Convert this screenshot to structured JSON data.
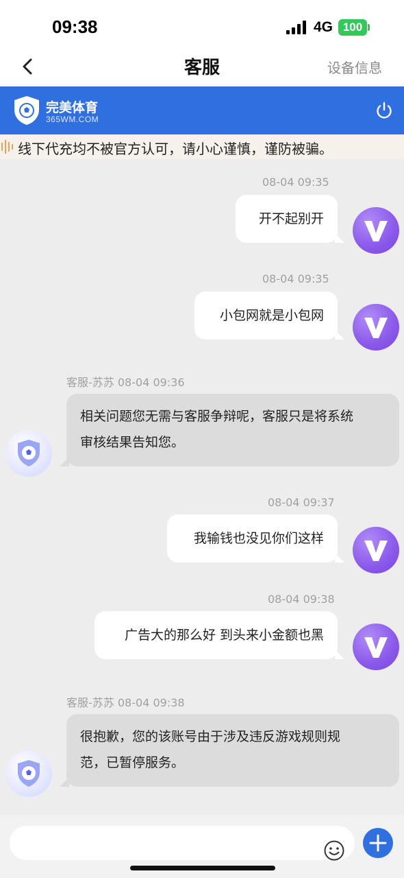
{
  "status_bar": {
    "time": "09:38",
    "network": "4G",
    "battery": "100"
  },
  "nav": {
    "title": "客服",
    "action": "设备信息"
  },
  "brand": {
    "name": "完美体育",
    "domain": "365WM.COM"
  },
  "notice": {
    "text": "线下代充均不被官方认可，请小心谨慎，谨防被骗。"
  },
  "messages": [
    {
      "side": "right",
      "timestamp": "08-04 09:35",
      "lines": [
        "开不起别开"
      ]
    },
    {
      "side": "right",
      "timestamp": "08-04 09:35",
      "lines": [
        "小包网就是小包网"
      ]
    },
    {
      "side": "left",
      "sender": "客服-苏苏",
      "timestamp": "08-04 09:36",
      "lines": [
        "相关问题您无需与客服争辩呢，客服只是将系统",
        "审核结果告知您。"
      ]
    },
    {
      "side": "right",
      "timestamp": "08-04 09:37",
      "lines": [
        "我输钱也没见你们这样"
      ]
    },
    {
      "side": "right",
      "timestamp": "08-04 09:38",
      "lines": [
        "广告大的那么好 到头来小金额也黑"
      ]
    },
    {
      "side": "left",
      "sender": "客服-苏苏",
      "timestamp": "08-04 09:38",
      "lines": [
        "很抱歉，您的该账号由于涉及违反游戏规则规",
        "范，已暂停服务。"
      ]
    }
  ],
  "colors": {
    "brand_blue": "#2f6fe0",
    "user_avatar": "#8a58ea",
    "agent_bubble": "#dcdcdc"
  },
  "icons": {
    "back": "chevron-left-icon",
    "power": "power-icon",
    "emoji": "smiley-icon",
    "add": "plus-icon",
    "user_avatar": "v-letter-icon",
    "agent_avatar": "shield-ball-icon"
  }
}
